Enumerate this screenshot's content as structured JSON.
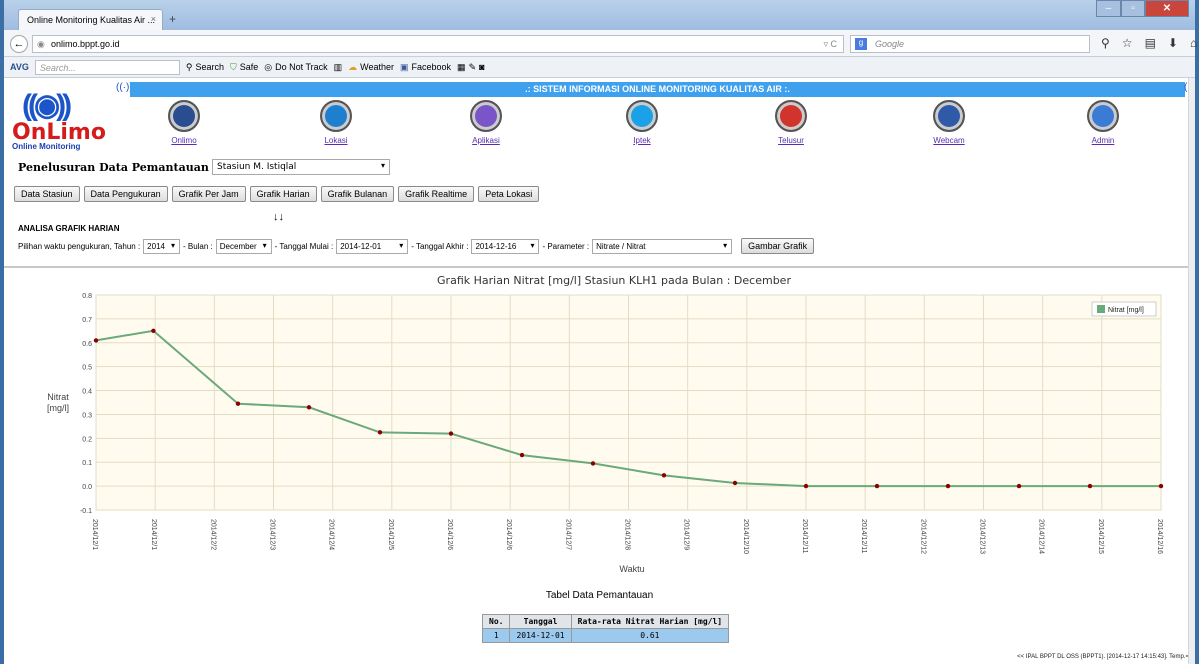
{
  "browser": {
    "tab_title": "Online Monitoring Kualitas Air ...",
    "url": "onlimo.bppt.go.id",
    "search_placeholder": "Google",
    "avg_label": "AVG",
    "avg_search_placeholder": "Search...",
    "toolbar": [
      "Search",
      "Safe",
      "Do Not Track",
      "Weather",
      "Facebook"
    ]
  },
  "site": {
    "logo_text": "OnLimo",
    "logo_sub": "Online Monitoring",
    "banner": ".: SISTEM INFORMASI ONLINE MONITORING KUALITAS AIR :.",
    "menu": [
      {
        "label": "Onlimo",
        "color": "#2a4d8f"
      },
      {
        "label": "Lokasi",
        "color": "#1e7fd1"
      },
      {
        "label": "Aplikasi",
        "color": "#7a55c8"
      },
      {
        "label": "Iptek",
        "color": "#1aa1e8"
      },
      {
        "label": "Telusur",
        "color": "#d0342c"
      },
      {
        "label": "Webcam",
        "color": "#2e5aa8"
      },
      {
        "label": "Admin",
        "color": "#3a7bd5"
      }
    ]
  },
  "form": {
    "stasiun_label": "Penelusuran Data Pemantauan Stasiun :",
    "stasiun_value": "Stasiun M. Istiqlal",
    "buttons": [
      "Data Stasiun",
      "Data Pengukuran",
      "Grafik Per Jam",
      "Grafik Harian",
      "Grafik Bulanan",
      "Grafik Realtime",
      "Peta Lokasi"
    ],
    "arrows": "↓↓",
    "section_title": "ANALISA GRAFIK HARIAN",
    "pilihan_label": "Pilihan waktu pengukuran, Tahun :",
    "tahun": "2014",
    "bulan_label": "- Bulan :",
    "bulan": "December",
    "mulai_label": "- Tanggal Mulai :",
    "mulai": "2014-12-01",
    "akhir_label": "- Tanggal Akhir :",
    "akhir": "2014-12-16",
    "parameter_label": "- Parameter :",
    "parameter": "Nitrate / Nitrat",
    "gambar_button": "Gambar Grafik"
  },
  "chart_data": {
    "type": "line",
    "title": "Grafik Harian Nitrat [mg/l] Stasiun KLH1 pada Bulan : December",
    "xlabel": "Waktu",
    "ylabel": "Nitrat [mg/l]",
    "ylim": [
      -0.1,
      0.8
    ],
    "yticks": [
      "-0.1",
      "0.0",
      "0.1",
      "0.2",
      "0.3",
      "0.4",
      "0.5",
      "0.6",
      "0.7",
      "0.8"
    ],
    "xticks": [
      "2014/12/1",
      "2014/12/1",
      "2014/12/2",
      "2014/12/3",
      "2014/12/4",
      "2014/12/5",
      "2014/12/6",
      "2014/12/6",
      "2014/12/7",
      "2014/12/8",
      "2014/12/9",
      "2014/12/10",
      "2014/12/11",
      "2014/12/11",
      "2014/12/12",
      "2014/12/13",
      "2014/12/14",
      "2014/12/15",
      "2014/12/16"
    ],
    "series": [
      {
        "name": "Nitrat [mg/l]",
        "color": "#6aa97a",
        "x": [
          0,
          0.97,
          2.4,
          3.6,
          4.8,
          6.0,
          7.2,
          8.4,
          9.6,
          10.8,
          12.0,
          13.2,
          14.4,
          15.6,
          16.8,
          18.0
        ],
        "values": [
          0.61,
          0.65,
          0.345,
          0.33,
          0.225,
          0.22,
          0.13,
          0.095,
          0.045,
          0.013,
          0.0,
          0.0,
          0.0,
          0.0,
          0.0,
          0.0
        ]
      }
    ],
    "legend": "top-right",
    "grid": true
  },
  "table": {
    "title": "Tabel Data Pemantauan",
    "headers": [
      "No.",
      "Tanggal",
      "Rata-rata Nitrat Harian [mg/l]"
    ],
    "rows": [
      [
        "1",
        "2014-12-01",
        "0.61"
      ]
    ]
  },
  "footer": "<< IPAL BPPT DL OSS (BPPT1). [2014-12-17 14:15:43]. Temp.="
}
